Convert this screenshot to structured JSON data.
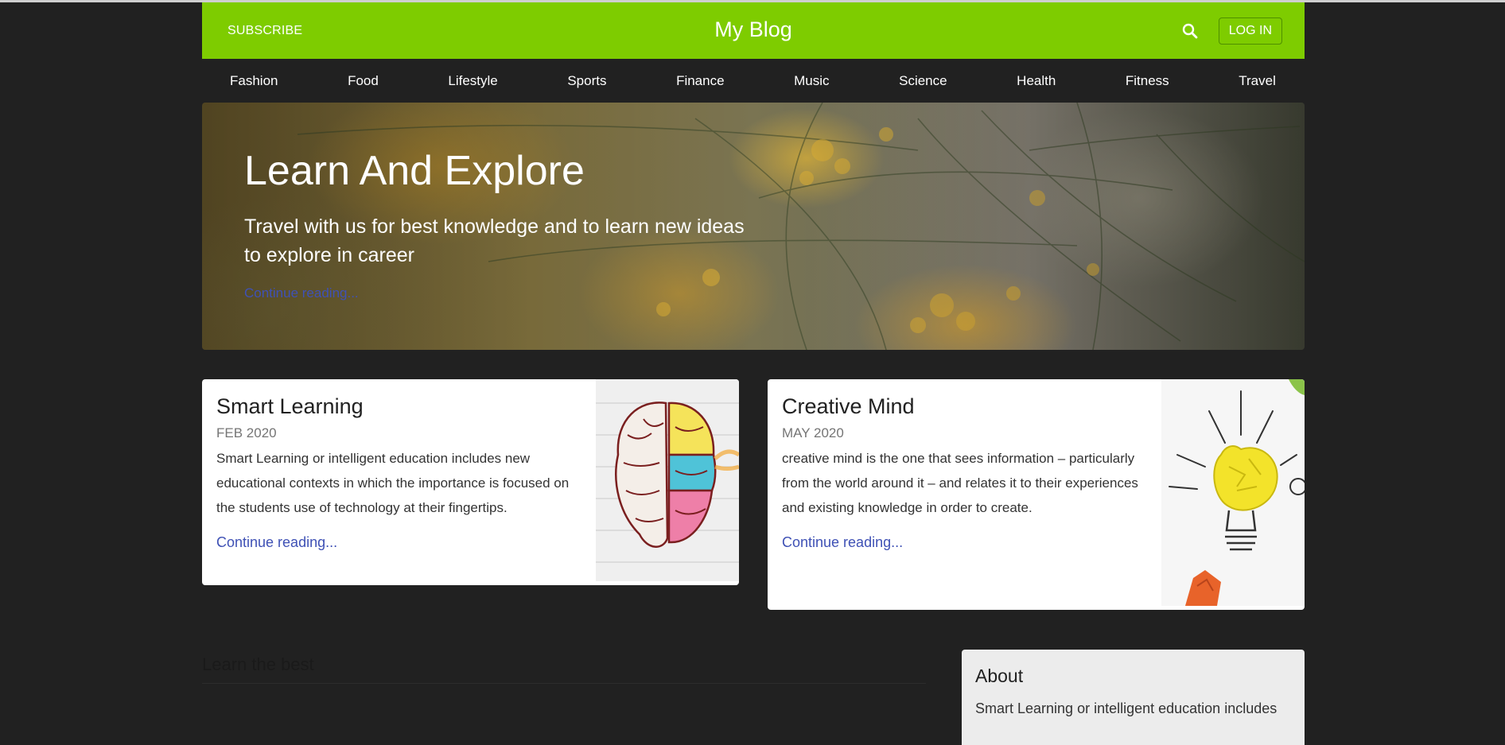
{
  "header": {
    "subscribe_label": "SUBSCRIBE",
    "brand": "My Blog",
    "login_label": "LOG IN",
    "accent_color": "#7ecc00"
  },
  "nav": {
    "items": [
      "Fashion",
      "Food",
      "Lifestyle",
      "Sports",
      "Finance",
      "Music",
      "Science",
      "Health",
      "Fitness",
      "Travel"
    ]
  },
  "hero": {
    "title": "Learn And Explore",
    "text": "Travel with us for best knowledge and to learn new ideas to explore in career",
    "link": "Continue reading..."
  },
  "cards": [
    {
      "title": "Smart Learning",
      "date": "FEB 2020",
      "text": "Smart Learning or intelligent education includes new educational contexts in which the importance is focused on the students use of technology at their fingertips.",
      "link": "Continue reading...",
      "image": "brain-illustration"
    },
    {
      "title": "Creative Mind",
      "date": "MAY 2020",
      "text": "creative mind is the one that sees information – particularly from the world around it – and relates it to their experiences and existing knowledge in order to create.",
      "link": "Continue reading...",
      "image": "lightbulb-illustration"
    }
  ],
  "main": {
    "section_heading": "Learn the best"
  },
  "about": {
    "title": "About",
    "text": "Smart Learning or intelligent education includes"
  },
  "icons": {
    "search": "search-icon"
  }
}
